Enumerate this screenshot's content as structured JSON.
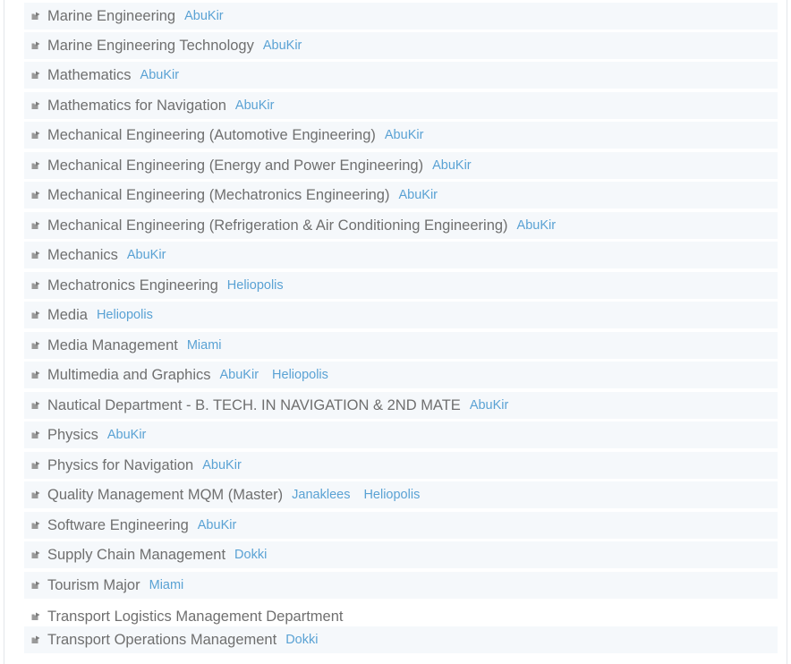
{
  "programs": [
    {
      "title": "Marine Engineering",
      "campuses": [
        "AbuKir"
      ]
    },
    {
      "title": "Marine Engineering Technology",
      "campuses": [
        "AbuKir"
      ]
    },
    {
      "title": "Mathematics",
      "campuses": [
        "AbuKir"
      ]
    },
    {
      "title": "Mathematics for Navigation",
      "campuses": [
        "AbuKir"
      ]
    },
    {
      "title": "Mechanical Engineering (Automotive Engineering)",
      "campuses": [
        "AbuKir"
      ]
    },
    {
      "title": "Mechanical Engineering (Energy and Power Engineering)",
      "campuses": [
        "AbuKir"
      ]
    },
    {
      "title": "Mechanical Engineering (Mechatronics Engineering)",
      "campuses": [
        "AbuKir"
      ]
    },
    {
      "title": "Mechanical Engineering (Refrigeration & Air Conditioning Engineering)",
      "campuses": [
        "AbuKir"
      ]
    },
    {
      "title": "Mechanics",
      "campuses": [
        "AbuKir"
      ]
    },
    {
      "title": "Mechatronics Engineering",
      "campuses": [
        "Heliopolis"
      ]
    },
    {
      "title": "Media",
      "campuses": [
        "Heliopolis"
      ]
    },
    {
      "title": "Media Management",
      "campuses": [
        "Miami"
      ]
    },
    {
      "title": "Multimedia and Graphics",
      "campuses": [
        "AbuKir",
        "Heliopolis"
      ]
    },
    {
      "title": "Nautical Department - B. TECH. IN NAVIGATION & 2ND MATE",
      "campuses": [
        "AbuKir"
      ]
    },
    {
      "title": "Physics",
      "campuses": [
        "AbuKir"
      ]
    },
    {
      "title": "Physics for Navigation",
      "campuses": [
        "AbuKir"
      ]
    },
    {
      "title": "Quality Management MQM (Master)",
      "campuses": [
        "Janaklees",
        "Heliopolis"
      ]
    },
    {
      "title": "Software Engineering",
      "campuses": [
        "AbuKir"
      ]
    },
    {
      "title": "Supply Chain Management",
      "campuses": [
        "Dokki"
      ]
    },
    {
      "title": "Tourism Major",
      "campuses": [
        "Miami"
      ]
    },
    {
      "title": "Transport Logistics Management Department",
      "campuses": []
    },
    {
      "title": "Transport Operations Management",
      "campuses": [
        "Dokki"
      ]
    }
  ],
  "colors": {
    "row_bg": "#f5f8fb",
    "title_text": "#6f6f6f",
    "campus_link": "#5aa2d4"
  },
  "icons": {
    "bullet": "folder-arrow-icon"
  }
}
